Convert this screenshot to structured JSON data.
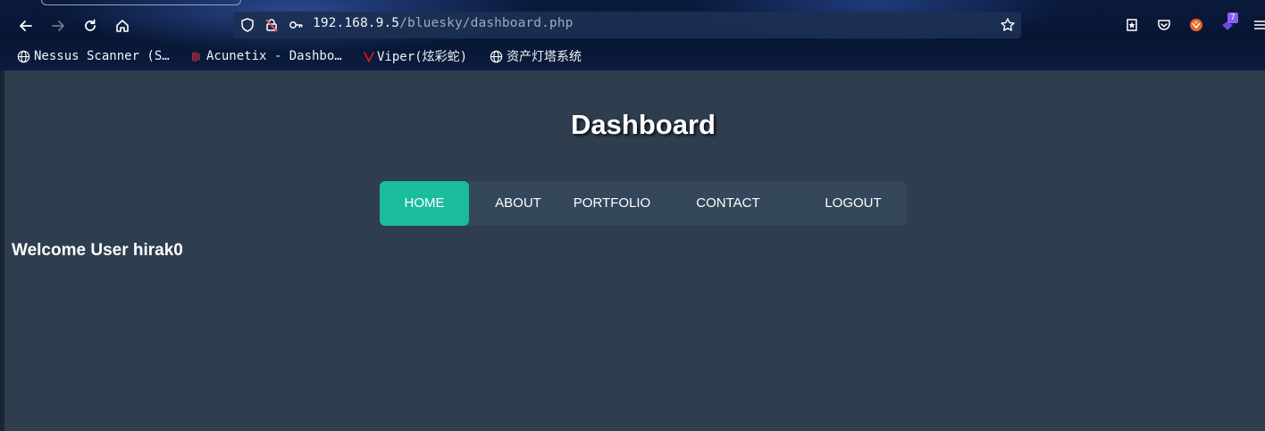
{
  "browser": {
    "url_host": "192.168.9.5",
    "url_path": "/bluesky/dashboard.php",
    "extension_badge": "7",
    "bookmarks": [
      {
        "label": "Nessus Scanner (S…",
        "icon": "globe-icon"
      },
      {
        "label": "Acunetix - Dashbo…",
        "icon": "acunetix-icon"
      },
      {
        "label": "Viper(炫彩蛇)",
        "icon": "viper-icon"
      },
      {
        "label": "资产灯塔系统",
        "icon": "globe-icon"
      }
    ]
  },
  "page": {
    "title": "Dashboard",
    "nav": [
      {
        "label": "HOME",
        "active": true
      },
      {
        "label": "ABOUT",
        "active": false
      },
      {
        "label": "PORTFOLIO",
        "active": false
      },
      {
        "label": "CONTACT",
        "active": false
      },
      {
        "label": "LOGOUT",
        "active": false
      }
    ],
    "welcome": "Welcome User hirak0"
  },
  "colors": {
    "page_bg": "#2f3e4f",
    "nav_bg": "#35475a",
    "accent": "#1abc9c"
  }
}
